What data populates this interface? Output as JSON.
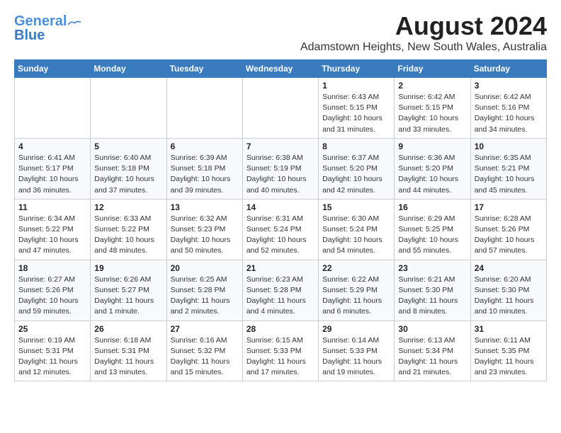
{
  "header": {
    "logo_line1": "General",
    "logo_line2": "Blue",
    "title": "August 2024",
    "subtitle": "Adamstown Heights, New South Wales, Australia"
  },
  "weekdays": [
    "Sunday",
    "Monday",
    "Tuesday",
    "Wednesday",
    "Thursday",
    "Friday",
    "Saturday"
  ],
  "weeks": [
    [
      {
        "day": "",
        "info": ""
      },
      {
        "day": "",
        "info": ""
      },
      {
        "day": "",
        "info": ""
      },
      {
        "day": "",
        "info": ""
      },
      {
        "day": "1",
        "info": "Sunrise: 6:43 AM\nSunset: 5:15 PM\nDaylight: 10 hours\nand 31 minutes."
      },
      {
        "day": "2",
        "info": "Sunrise: 6:42 AM\nSunset: 5:15 PM\nDaylight: 10 hours\nand 33 minutes."
      },
      {
        "day": "3",
        "info": "Sunrise: 6:42 AM\nSunset: 5:16 PM\nDaylight: 10 hours\nand 34 minutes."
      }
    ],
    [
      {
        "day": "4",
        "info": "Sunrise: 6:41 AM\nSunset: 5:17 PM\nDaylight: 10 hours\nand 36 minutes."
      },
      {
        "day": "5",
        "info": "Sunrise: 6:40 AM\nSunset: 5:18 PM\nDaylight: 10 hours\nand 37 minutes."
      },
      {
        "day": "6",
        "info": "Sunrise: 6:39 AM\nSunset: 5:18 PM\nDaylight: 10 hours\nand 39 minutes."
      },
      {
        "day": "7",
        "info": "Sunrise: 6:38 AM\nSunset: 5:19 PM\nDaylight: 10 hours\nand 40 minutes."
      },
      {
        "day": "8",
        "info": "Sunrise: 6:37 AM\nSunset: 5:20 PM\nDaylight: 10 hours\nand 42 minutes."
      },
      {
        "day": "9",
        "info": "Sunrise: 6:36 AM\nSunset: 5:20 PM\nDaylight: 10 hours\nand 44 minutes."
      },
      {
        "day": "10",
        "info": "Sunrise: 6:35 AM\nSunset: 5:21 PM\nDaylight: 10 hours\nand 45 minutes."
      }
    ],
    [
      {
        "day": "11",
        "info": "Sunrise: 6:34 AM\nSunset: 5:22 PM\nDaylight: 10 hours\nand 47 minutes."
      },
      {
        "day": "12",
        "info": "Sunrise: 6:33 AM\nSunset: 5:22 PM\nDaylight: 10 hours\nand 48 minutes."
      },
      {
        "day": "13",
        "info": "Sunrise: 6:32 AM\nSunset: 5:23 PM\nDaylight: 10 hours\nand 50 minutes."
      },
      {
        "day": "14",
        "info": "Sunrise: 6:31 AM\nSunset: 5:24 PM\nDaylight: 10 hours\nand 52 minutes."
      },
      {
        "day": "15",
        "info": "Sunrise: 6:30 AM\nSunset: 5:24 PM\nDaylight: 10 hours\nand 54 minutes."
      },
      {
        "day": "16",
        "info": "Sunrise: 6:29 AM\nSunset: 5:25 PM\nDaylight: 10 hours\nand 55 minutes."
      },
      {
        "day": "17",
        "info": "Sunrise: 6:28 AM\nSunset: 5:26 PM\nDaylight: 10 hours\nand 57 minutes."
      }
    ],
    [
      {
        "day": "18",
        "info": "Sunrise: 6:27 AM\nSunset: 5:26 PM\nDaylight: 10 hours\nand 59 minutes."
      },
      {
        "day": "19",
        "info": "Sunrise: 6:26 AM\nSunset: 5:27 PM\nDaylight: 11 hours\nand 1 minute."
      },
      {
        "day": "20",
        "info": "Sunrise: 6:25 AM\nSunset: 5:28 PM\nDaylight: 11 hours\nand 2 minutes."
      },
      {
        "day": "21",
        "info": "Sunrise: 6:23 AM\nSunset: 5:28 PM\nDaylight: 11 hours\nand 4 minutes."
      },
      {
        "day": "22",
        "info": "Sunrise: 6:22 AM\nSunset: 5:29 PM\nDaylight: 11 hours\nand 6 minutes."
      },
      {
        "day": "23",
        "info": "Sunrise: 6:21 AM\nSunset: 5:30 PM\nDaylight: 11 hours\nand 8 minutes."
      },
      {
        "day": "24",
        "info": "Sunrise: 6:20 AM\nSunset: 5:30 PM\nDaylight: 11 hours\nand 10 minutes."
      }
    ],
    [
      {
        "day": "25",
        "info": "Sunrise: 6:19 AM\nSunset: 5:31 PM\nDaylight: 11 hours\nand 12 minutes."
      },
      {
        "day": "26",
        "info": "Sunrise: 6:18 AM\nSunset: 5:31 PM\nDaylight: 11 hours\nand 13 minutes."
      },
      {
        "day": "27",
        "info": "Sunrise: 6:16 AM\nSunset: 5:32 PM\nDaylight: 11 hours\nand 15 minutes."
      },
      {
        "day": "28",
        "info": "Sunrise: 6:15 AM\nSunset: 5:33 PM\nDaylight: 11 hours\nand 17 minutes."
      },
      {
        "day": "29",
        "info": "Sunrise: 6:14 AM\nSunset: 5:33 PM\nDaylight: 11 hours\nand 19 minutes."
      },
      {
        "day": "30",
        "info": "Sunrise: 6:13 AM\nSunset: 5:34 PM\nDaylight: 11 hours\nand 21 minutes."
      },
      {
        "day": "31",
        "info": "Sunrise: 6:11 AM\nSunset: 5:35 PM\nDaylight: 11 hours\nand 23 minutes."
      }
    ]
  ]
}
